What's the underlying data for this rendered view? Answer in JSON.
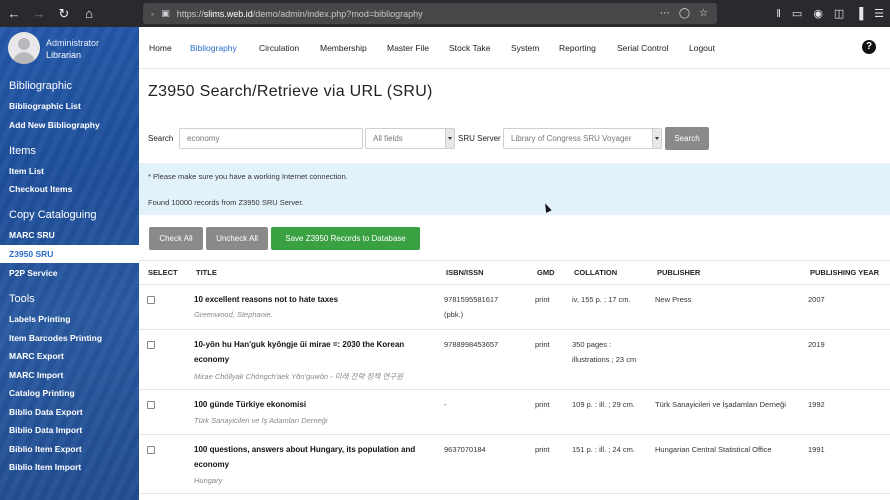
{
  "browser": {
    "url_host": "slims.web.id",
    "url_path": "/demo/admin/index.php?mod=bibliography",
    "url_prefix": "https://"
  },
  "user": {
    "name": "Administrator",
    "role": "Librarian"
  },
  "sidebar": {
    "sections": [
      {
        "title": "Bibliographic",
        "items": [
          "Bibliographic List",
          "Add New Bibliography"
        ]
      },
      {
        "title": "Items",
        "items": [
          "Item List",
          "Checkout Items"
        ]
      },
      {
        "title": "Copy Cataloguing",
        "items": [
          "MARC SRU",
          "Z3950 SRU",
          "P2P Service"
        ]
      },
      {
        "title": "Tools",
        "items": [
          "Labels Printing",
          "Item Barcodes Printing",
          "MARC Export",
          "MARC Import",
          "Catalog Printing",
          "Biblio Data Export",
          "Biblio Data Import",
          "Biblio Item Export",
          "Biblio Item Import"
        ]
      }
    ],
    "active_item": "Z3950 SRU"
  },
  "topnav": {
    "items": [
      "Home",
      "Bibliography",
      "Circulation",
      "Membership",
      "Master File",
      "Stock Take",
      "System",
      "Reporting",
      "Serial Control",
      "Logout"
    ],
    "active": "Bibliography"
  },
  "page": {
    "title": "Z3950 Search/Retrieve via URL (SRU)"
  },
  "search": {
    "label": "Search",
    "value": "economy",
    "field_select": "All fields",
    "server_label": "SRU Server",
    "server_select": "Library of Congress SRU Voyager",
    "button": "Search"
  },
  "info": {
    "notice": "* Please make sure you have a working Internet connection.",
    "found": "Found 10000 records from Z3950 SRU Server."
  },
  "actions": {
    "check_all": "Check All",
    "uncheck_all": "Uncheck All",
    "save": "Save Z3950 Records to Database"
  },
  "table": {
    "headers": [
      "SELECT",
      "TITLE",
      "ISBN/ISSN",
      "GMD",
      "COLLATION",
      "PUBLISHER",
      "PUBLISHING YEAR"
    ],
    "rows": [
      {
        "title": "10 excellent reasons not to hate taxes",
        "author": "Greenwood, Stephanie.",
        "isbn": "9781595581617 (pbk.)",
        "gmd": "print",
        "collation": "iv, 155 p. ; 17 cm.",
        "publisher": "New Press",
        "year": "2007"
      },
      {
        "title": "10-yŏn hu Han'guk kyŏngje ŭi mirae =: 2030 the Korean economy",
        "author": "Mirae Chŏllyak Chŏngch'aek Yŏn'guwŏn - 미래 전략 정책 연구원",
        "isbn": "9788998453657",
        "gmd": "print",
        "collation": "350 pages : illustrations ; 23 cm",
        "publisher": "",
        "year": "2019"
      },
      {
        "title": "100 günde Türkiye ekonomisi",
        "author": "Türk Sanayicileri ve İş Adamları Derneği",
        "isbn": "-",
        "gmd": "print",
        "collation": "109 p. : ill. ; 29 cm.",
        "publisher": "Türk Sanayicileri ve İşadamları Derneği",
        "year": "1992"
      },
      {
        "title": "100 questions, answers about Hungary, its population and economy",
        "author": "Hungary",
        "isbn": "9637070184",
        "gmd": "print",
        "collation": "151 p. : ill. ; 24 cm.",
        "publisher": "Hungarian Central Statistical Office",
        "year": "1991"
      }
    ]
  }
}
